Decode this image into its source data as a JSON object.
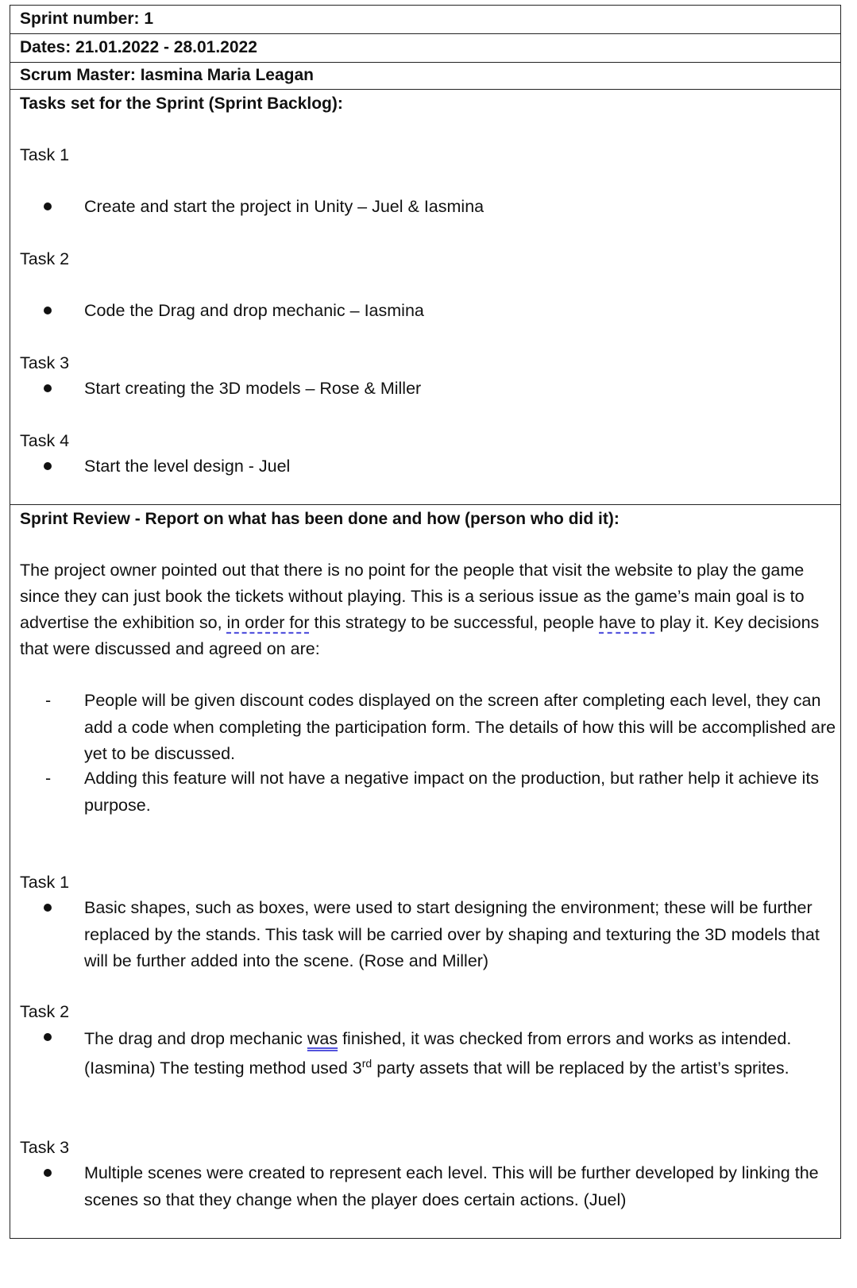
{
  "header": {
    "sprint_number": "Sprint number: 1",
    "dates": "Dates: 21.01.2022 - 28.01.2022",
    "scrum_master": "Scrum Master: Iasmina Maria Leagan"
  },
  "backlog": {
    "title": "Tasks set for the Sprint (Sprint Backlog):",
    "tasks": [
      {
        "label": "Task 1",
        "item": "Create and start the project in Unity – Juel & Iasmina"
      },
      {
        "label": "Task 2",
        "item": "Code the Drag and drop mechanic – Iasmina"
      },
      {
        "label": "Task 3",
        "item": "Start creating the 3D models – Rose & Miller"
      },
      {
        "label": "Task 4",
        "item": "Start the level design - Juel"
      }
    ]
  },
  "review": {
    "title": "Sprint Review - Report on what has been done and how (person who did it):",
    "intro_part1": "The project owner pointed out that there is no point for the people that visit the website to play the game since they can just book the tickets without playing. This is a serious issue as the game’s main goal is to advertise the exhibition so, ",
    "intro_squiggle1": "in order for",
    "intro_part2": " this strategy to be successful, people ",
    "intro_squiggle2": "have to",
    "intro_part3": " play it. Key decisions that were discussed and agreed on are:",
    "dash_items": [
      "People will be given discount codes displayed on the screen after completing each level, they can add a code when completing the participation form. The details of how this will be accomplished are yet to be discussed.",
      "Adding this feature will not have a negative impact on the production, but rather help it achieve its purpose."
    ],
    "tasks": [
      {
        "label": "Task 1",
        "text": "Basic shapes, such as boxes, were used to start designing the environment; these will be further replaced by the stands. This task will be carried over by shaping and texturing the 3D models that will be further added into the scene. (Rose and Miller)"
      },
      {
        "label": "Task 2",
        "text_part1": "The drag and drop mechanic ",
        "text_marked": "was",
        "text_part2": " finished, it was checked from errors and works as intended. (Iasmina) The testing method used 3",
        "text_sup": "rd",
        "text_part3": " party assets that will be replaced by the artist’s sprites."
      },
      {
        "label": "Task 3",
        "text": "Multiple scenes were created to represent each level. This will be further developed by linking the scenes so that they change when the player does certain actions. (Juel)"
      }
    ]
  }
}
